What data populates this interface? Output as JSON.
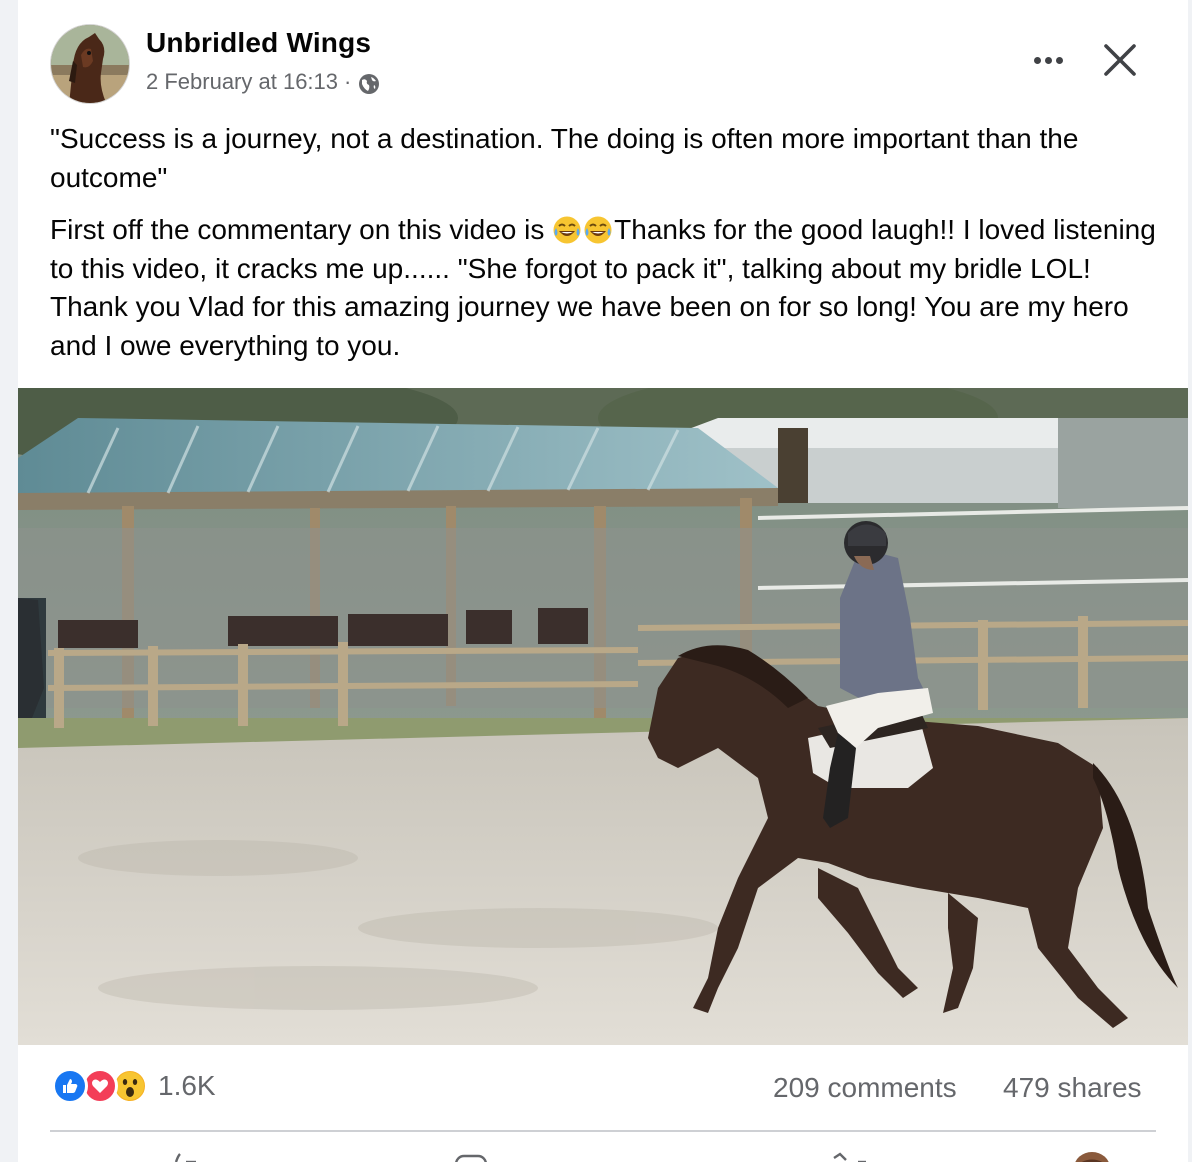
{
  "post": {
    "author": "Unbridled Wings",
    "timestamp": "2 February at 16:13",
    "separator": "·",
    "privacy_icon": "globe-icon",
    "quote": "\"Success is a journey, not a destination. The doing is often more important than the outcome\"",
    "body_part1": "First off the commentary on this video is ",
    "body_part2": "Thanks for the good laugh!! I loved listening to this video, it cracks me up...... \"She forgot to pack it\", talking about my bridle LOL! Thank you Vlad for this amazing journey we have been on for so long! You are my hero and I owe everything to you.",
    "emoji": "laughing-tears-emoji"
  },
  "stats": {
    "reactions": [
      "like",
      "love",
      "wow"
    ],
    "reaction_count": "1.6K",
    "comments": "209 comments",
    "shares": "479 shares"
  },
  "actions": [
    "like-icon",
    "comment-icon",
    "share-icon",
    "profile-avatar"
  ],
  "colors": {
    "like": "#1877f2",
    "love": "#f33e58",
    "wow": "#f7b125",
    "secondary_text": "#65676b",
    "divider": "#ced0d4"
  }
}
